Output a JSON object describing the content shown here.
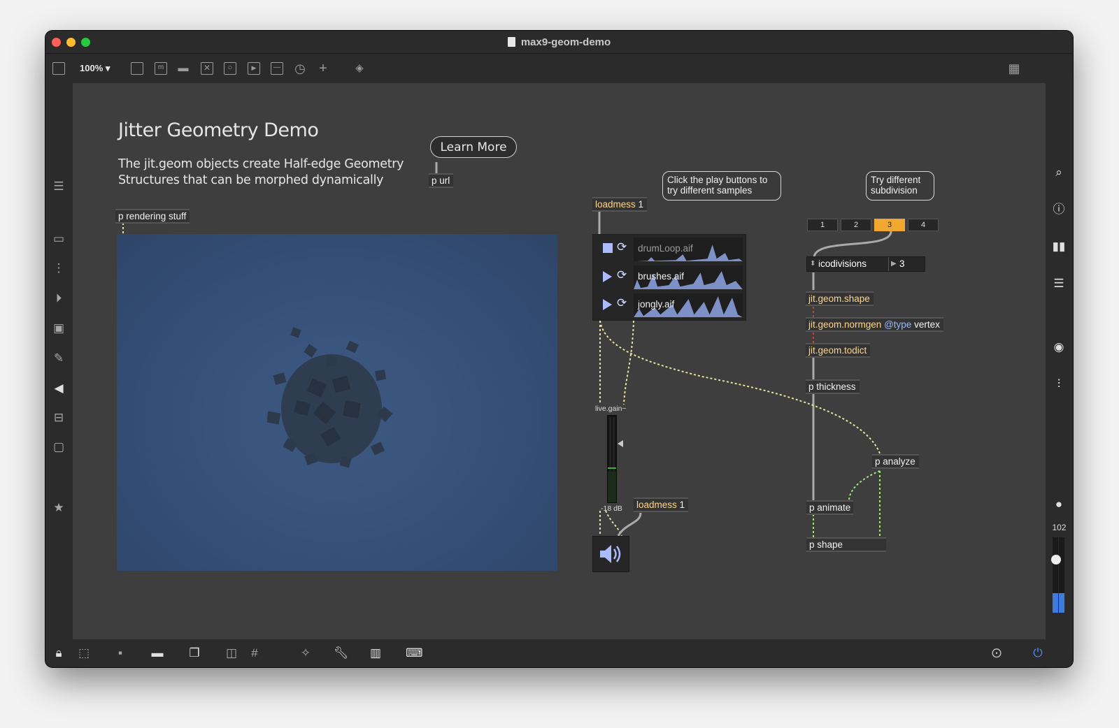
{
  "window": {
    "title": "max9-geom-demo"
  },
  "toolbar": {
    "zoom": "100%"
  },
  "canvas": {
    "heading": "Jitter Geometry Demo",
    "description": "The jit.geom objects create Half-edge Geometry Structures that can be morphed dynamically",
    "learn_more": "Learn More",
    "objects": {
      "p_url": "p url",
      "p_rendering": "p rendering stuff",
      "loadmess1_kw": "loadmess",
      "loadmess1_arg": "1",
      "loadmess2_kw": "loadmess",
      "loadmess2_arg": "1",
      "geom_shape": "jit.geom.shape",
      "normgen_name": "jit.geom.normgen",
      "normgen_attr": "@type",
      "normgen_val": "vertex",
      "todict": "jit.geom.todict",
      "p_thickness": "p thickness",
      "p_analyze": "p analyze",
      "p_animate": "p animate",
      "p_shape": "p shape"
    },
    "callouts": {
      "play": "Click the play buttons to try different samples",
      "subdiv": "Try different subdivision"
    },
    "players": [
      {
        "file": "drumLoop.aif",
        "state": "stop"
      },
      {
        "file": "brushes.aif",
        "state": "play"
      },
      {
        "file": "jongly.aif",
        "state": "play"
      }
    ],
    "segments": [
      "1",
      "2",
      "3",
      "4"
    ],
    "selected_segment": "3",
    "icodivisions": {
      "label": "icodivisions",
      "value": "3"
    },
    "gain": {
      "label": "live.gain~",
      "db": "-18 dB"
    }
  },
  "rightbar": {
    "value": "102"
  },
  "colors": {
    "accent": "#f0a830",
    "canvas": "#3e3e3e",
    "cable_yellow": "#e3e39a",
    "cable_green": "#9ee57a"
  }
}
